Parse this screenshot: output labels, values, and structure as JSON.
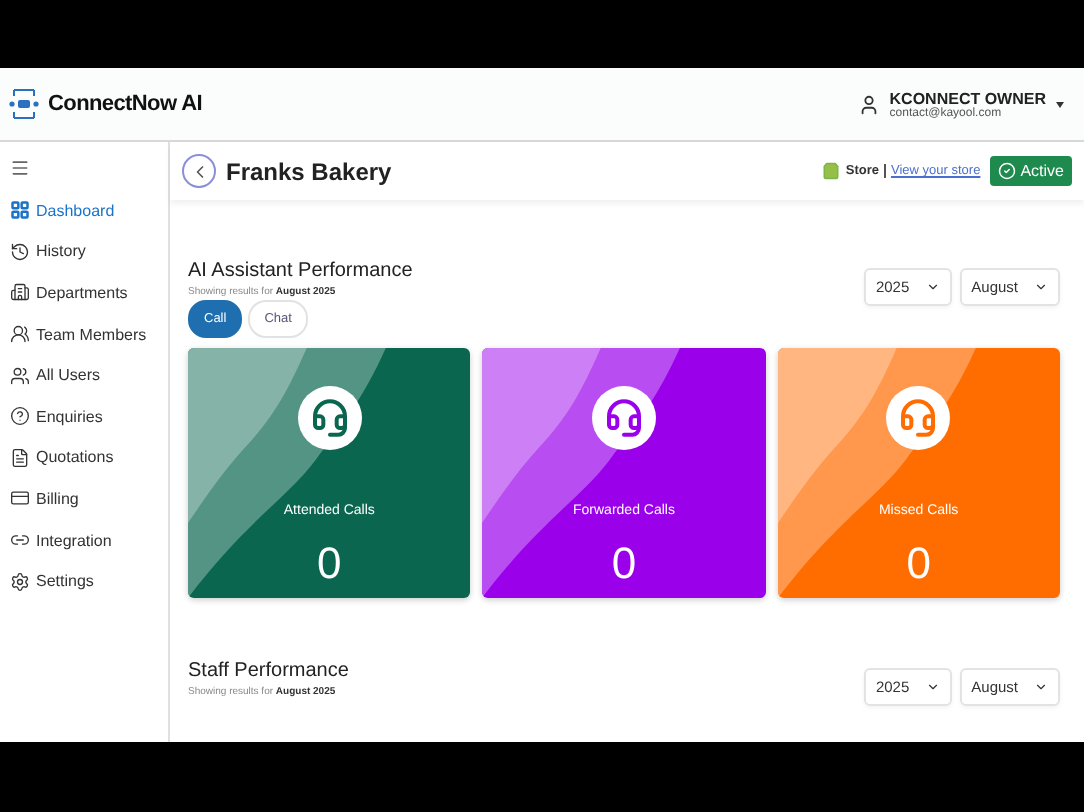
{
  "app": {
    "name": "ConnectNow AI"
  },
  "user": {
    "name": "KCONNECT OWNER",
    "email": "contact@kayool.com"
  },
  "sidebar": {
    "items": [
      {
        "label": "Dashboard",
        "selected": true
      },
      {
        "label": "History",
        "selected": false
      },
      {
        "label": "Departments",
        "selected": false
      },
      {
        "label": "Team Members",
        "selected": false
      },
      {
        "label": "All Users",
        "selected": false
      },
      {
        "label": "Enquiries",
        "selected": false
      },
      {
        "label": "Quotations",
        "selected": false
      },
      {
        "label": "Billing",
        "selected": false
      },
      {
        "label": "Integration",
        "selected": false
      },
      {
        "label": "Settings",
        "selected": false
      }
    ]
  },
  "page": {
    "title": "Franks Bakery",
    "store_label": "Store",
    "store_link": "View your store",
    "status": "Active"
  },
  "sections": [
    {
      "title": "AI Assistant Performance",
      "subtitle": "Showing results for **August 2025**",
      "year": "2025",
      "month": "August",
      "tabs": [
        {
          "label": "Call",
          "selected": true
        },
        {
          "label": "Chat",
          "selected": false
        }
      ],
      "cards": [
        {
          "label": "Attended Calls",
          "value": "0",
          "color": "#0b6650"
        },
        {
          "label": "Forwarded Calls",
          "value": "0",
          "color": "#9a00ea"
        },
        {
          "label": "Missed Calls",
          "value": "0",
          "color": "#ff6d00"
        }
      ]
    },
    {
      "title": "Staff Performance",
      "subtitle": "Showing results for **August 2025**",
      "year": "2025",
      "month": "August"
    }
  ]
}
